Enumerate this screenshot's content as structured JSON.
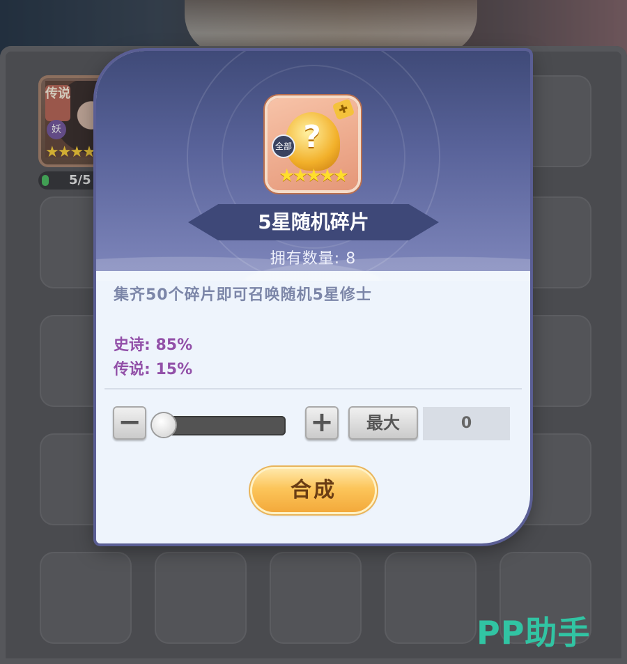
{
  "background": {
    "hero_card": {
      "tag": "传说",
      "race": "妖",
      "stars": "★★★★★",
      "progress": "5/5"
    },
    "watermark": "PP助手"
  },
  "modal": {
    "item_icon": {
      "badge_all": "全部",
      "stars": "★★★★★",
      "symbol": "?"
    },
    "item_name": "5星随机碎片",
    "owned_count": "拥有数量: 8",
    "description": "集齐50个碎片即可召唤随机5星修士",
    "rates": [
      {
        "label": "史诗: 85%"
      },
      {
        "label": "传说: 15%"
      }
    ],
    "quantity": {
      "minus_label": "−",
      "plus_label": "+",
      "max_label": "最大",
      "value": "0",
      "slider_fraction": 0
    },
    "compose_label": "合成"
  },
  "colors": {
    "modal_header": "#59639a",
    "modal_body": "#eef4fc",
    "rate_text": "#9250a8",
    "desc_text": "#7c86a8",
    "compose_button": "#fcc55a",
    "watermark": "#31c4a3"
  }
}
